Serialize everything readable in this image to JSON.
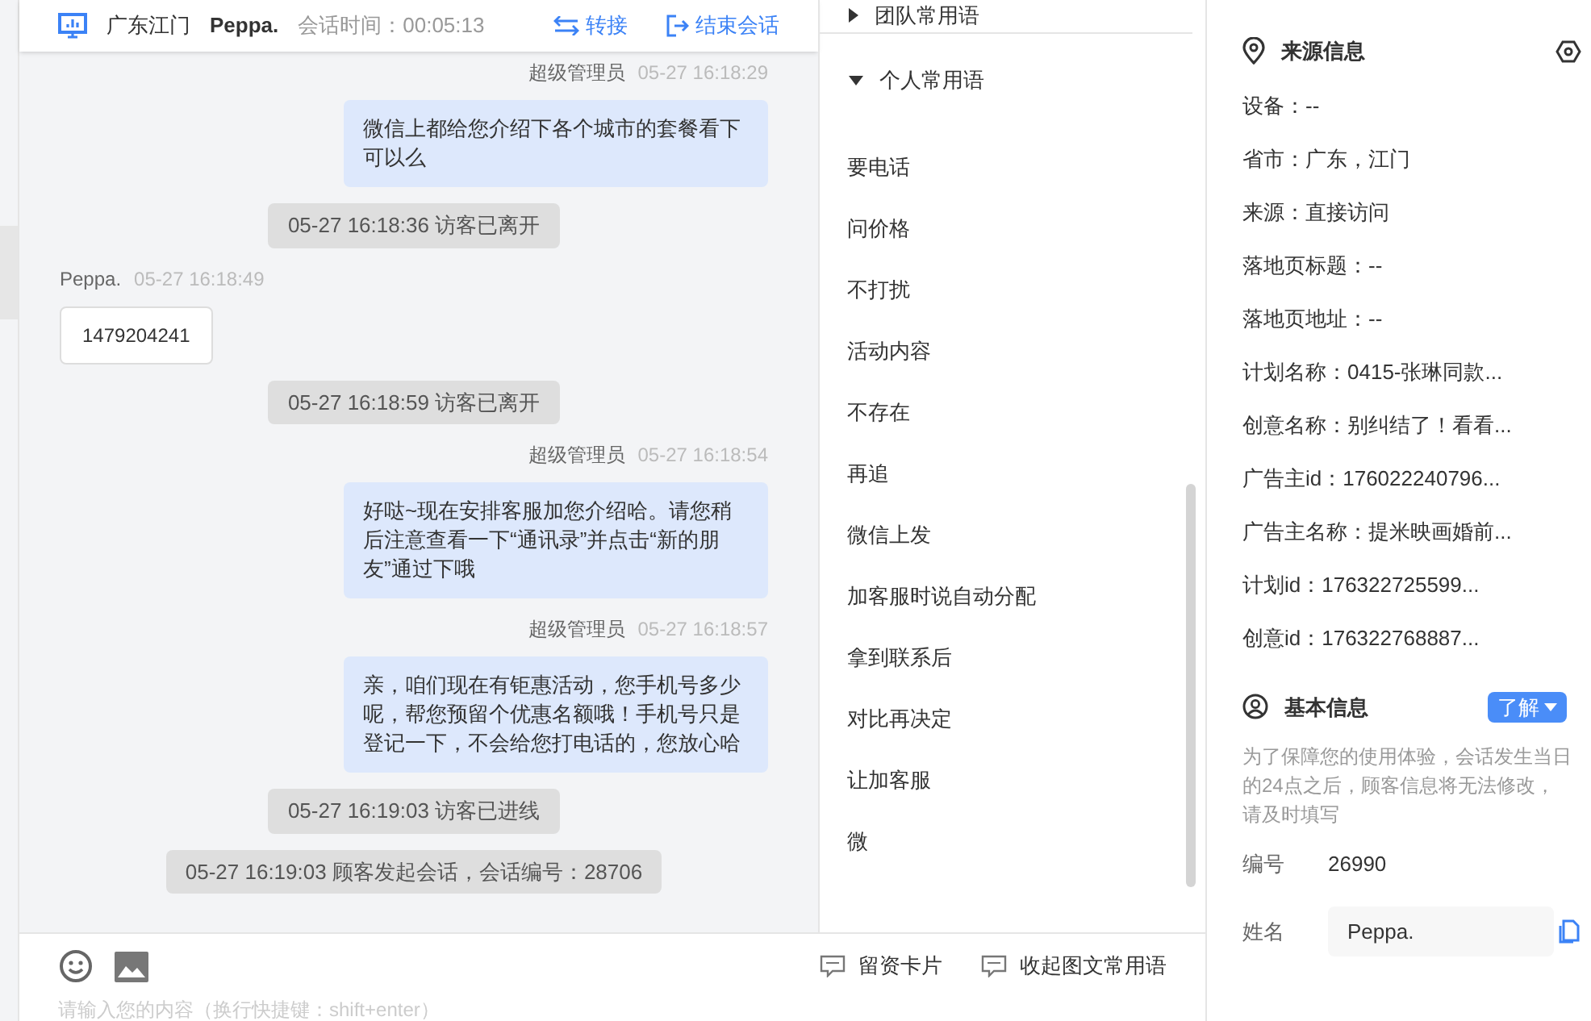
{
  "header": {
    "location": "广东江门",
    "visitor": "Peppa.",
    "duration": "会话时间：00:05:13",
    "actions": [
      {
        "label": "转接",
        "kind": "transfer"
      },
      {
        "label": "结束会话",
        "kind": "end"
      }
    ]
  },
  "messages": [
    {
      "kind": "agent",
      "sender": "超级管理员",
      "time": "05-27 16:18:29",
      "text": "微信上都给您介绍下各个城市的套餐看下可以么"
    },
    {
      "kind": "system",
      "text": "05-27 16:18:36 访客已离开"
    },
    {
      "kind": "visitor",
      "sender": "Peppa.",
      "time": "05-27 16:18:49",
      "text": "1479204241"
    },
    {
      "kind": "system",
      "text": "05-27 16:18:59 访客已离开"
    },
    {
      "kind": "agent",
      "sender": "超级管理员",
      "time": "05-27 16:18:54",
      "text": "好哒~现在安排客服加您介绍哈。请您稍后注意查看一下“通讯录”并点击“新的朋友”通过下哦"
    },
    {
      "kind": "agent",
      "sender": "超级管理员",
      "time": "05-27 16:18:57",
      "text": "亲，咱们现在有钜惠活动，您手机号多少呢，帮您预留个优惠名额哦！手机号只是登记一下，不会给您打电话的，您放心哈"
    },
    {
      "kind": "system",
      "text": "05-27 16:19:03 访客已进线"
    },
    {
      "kind": "system",
      "text": "05-27 16:19:03 顾客发起会话，会话编号：28706"
    }
  ],
  "input": {
    "placeholder": "请输入您的内容（换行快捷键：shift+enter）"
  },
  "toolbar": [
    "留资卡片",
    "收起图文常用语"
  ],
  "phrase_groups": [
    {
      "label": "团队常用语",
      "expanded": false
    },
    {
      "label": "个人常用语",
      "expanded": true,
      "items": [
        "要电话",
        "问价格",
        "不打扰",
        "活动内容",
        "不存在",
        "再追",
        "微信上发",
        "加客服时说自动分配",
        "拿到联系后",
        "对比再决定",
        "让加客服",
        "微"
      ]
    }
  ],
  "source_info": {
    "title": "来源信息",
    "fields": [
      "设备：--",
      "省市：广东，江门",
      "来源：直接访问",
      "落地页标题：--",
      "落地页地址：--",
      "计划名称：0415-张琳同款...",
      "创意名称：别纠结了！看看...",
      "广告主id：176022240796...",
      "广告主名称：提米映画婚前...",
      "计划id：176322725599...",
      "创意id：176322768887..."
    ]
  },
  "basic_info": {
    "title": "基本信息",
    "button": "了解",
    "notice": "为了保障您的使用体验，会话发生当日的24点之后，顾客信息将无法修改，请及时填写",
    "id_label": "编号",
    "id_value": "26990",
    "name_label": "姓名",
    "name_value": "Peppa."
  }
}
